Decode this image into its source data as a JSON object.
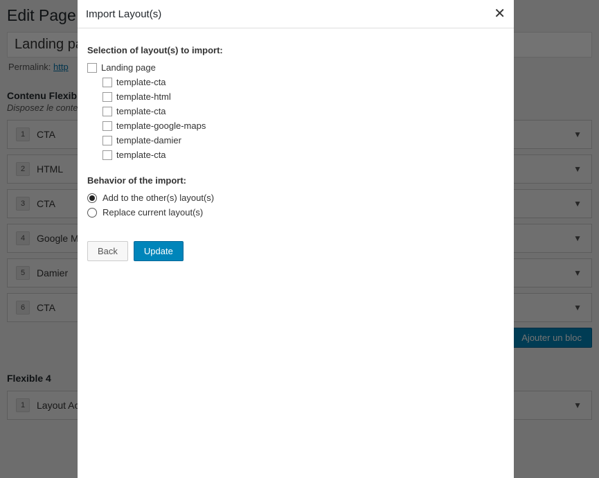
{
  "page": {
    "heading": "Edit Page",
    "title": "Landing page",
    "permalink_label": "Permalink: ",
    "permalink_url": "http"
  },
  "flexible": {
    "title": "Contenu Flexible",
    "subtitle": "Disposez le contenu",
    "add_button": "Ajouter un bloc",
    "rows": [
      {
        "num": "1",
        "label": "CTA"
      },
      {
        "num": "2",
        "label": "HTML"
      },
      {
        "num": "3",
        "label": "CTA"
      },
      {
        "num": "4",
        "label": "Google Maps"
      },
      {
        "num": "5",
        "label": "Damier"
      },
      {
        "num": "6",
        "label": "CTA"
      }
    ]
  },
  "flexible4": {
    "title": "Flexible 4",
    "rows": [
      {
        "num": "1",
        "label": "Layout Action"
      }
    ]
  },
  "modal": {
    "title": "Import Layout(s)",
    "selection_label": "Selection of layout(s) to import:",
    "checkboxes": [
      {
        "label": "Landing page",
        "child": false
      },
      {
        "label": "template-cta",
        "child": true
      },
      {
        "label": "template-html",
        "child": true
      },
      {
        "label": "template-cta",
        "child": true
      },
      {
        "label": "template-google-maps",
        "child": true
      },
      {
        "label": "template-damier",
        "child": true
      },
      {
        "label": "template-cta",
        "child": true
      }
    ],
    "behavior_label": "Behavior of the import:",
    "radios": [
      {
        "label": "Add to the other(s) layout(s)",
        "selected": true
      },
      {
        "label": "Replace current layout(s)",
        "selected": false
      }
    ],
    "back": "Back",
    "update": "Update"
  }
}
